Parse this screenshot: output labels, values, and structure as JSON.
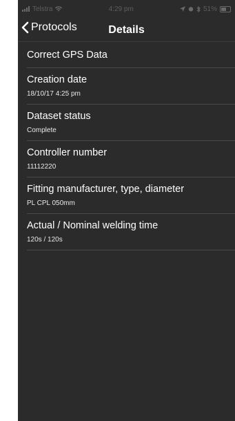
{
  "status_bar": {
    "carrier": "Telstra",
    "time": "4:29 pm",
    "battery": "51%"
  },
  "nav": {
    "back_label": "Protocols",
    "title": "Details"
  },
  "rows": [
    {
      "title": "Correct GPS Data"
    },
    {
      "title": "Creation date",
      "value": "18/10/17 4:25 pm"
    },
    {
      "title": "Dataset status",
      "value": "Complete"
    },
    {
      "title": "Controller number",
      "value": "11112220"
    },
    {
      "title": "Fitting manufacturer, type, diameter",
      "value": "PL CPL 050mm"
    },
    {
      "title": "Actual / Nominal welding time",
      "value": "120s / 120s"
    }
  ],
  "colors": {
    "background": "#2b2b2b",
    "text": "#ffffff",
    "separator": "#4a4a4a"
  }
}
